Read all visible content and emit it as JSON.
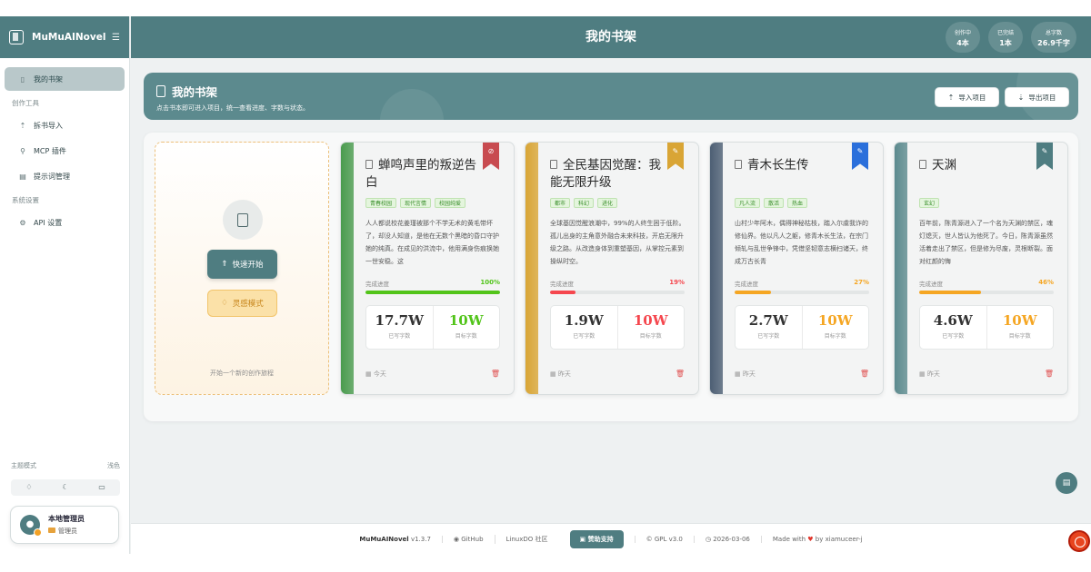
{
  "app": {
    "name": "MuMuAINovel",
    "page_title": "我的书架"
  },
  "sidebar": {
    "items": [
      {
        "label": "我的书架",
        "icon": "book-icon",
        "active": true
      },
      {
        "label": "拆书导入",
        "icon": "upload-icon"
      },
      {
        "label": "MCP 插件",
        "icon": "plug-icon"
      },
      {
        "label": "提示词管理",
        "icon": "file-text-icon"
      },
      {
        "label": "API 设置",
        "icon": "gear-icon"
      }
    ],
    "sections": {
      "tools": "创作工具",
      "system": "系统设置"
    },
    "theme": {
      "label": "主题模式",
      "current": "浅色",
      "options": [
        "bulb-icon",
        "moon-icon",
        "monitor-icon"
      ]
    },
    "user": {
      "name": "本地管理员",
      "role": "管理员"
    }
  },
  "topbar": {
    "stats": [
      {
        "label": "创作中",
        "value": "4本"
      },
      {
        "label": "已完结",
        "value": "1本"
      },
      {
        "label": "总字数",
        "value": "26.9千字"
      }
    ]
  },
  "banner": {
    "title": "我的书架",
    "subtitle": "点击书本即可进入项目，统一查看进度、字数与状态。",
    "import_label": "导入项目",
    "export_label": "导出项目"
  },
  "new_card": {
    "quick_start": "快速开始",
    "inspiration": "灵感模式",
    "footer": "开始一个新的创作旅程"
  },
  "labels": {
    "progress": "完成进度",
    "written": "已写字数",
    "target": "目标字数"
  },
  "books": [
    {
      "title": "蝉鸣声里的叛逆告白",
      "tags": [
        "青春校园",
        "现代言情",
        "校园纯爱"
      ],
      "description": "人人都说校花姜瑾被那个不学无术的黄毛带坏了，却没人知道，是他在无数个黑暗的昏口守护她的纯真。在成见的洪流中，他用满身伤痕换她一世安稳。这",
      "progress": "100%",
      "progress_value": 100,
      "written": "17.7W",
      "target": "10W",
      "date": "今天",
      "color": "#4a9b4e",
      "bar": "#52c41a",
      "rib": "#c84b50",
      "rib_icon": "check-circle-icon",
      "target_color": "#52c41a"
    },
    {
      "title": "全民基因觉醒：我能无限升级",
      "tags": [
        "都市",
        "科幻",
        "进化"
      ],
      "description": "全球基因觉醒浪潮中，99%的人终生困于低阶。孤儿出身的主角意外融合未来科技，开启无限升级之路。从改造身体到重塑基因，从掌控元素到操纵时空。",
      "progress": "19%",
      "progress_value": 19,
      "written": "1.9W",
      "target": "10W",
      "date": "昨天",
      "color": "#d9a535",
      "bar": "#f5474e",
      "rib": "#d9a535",
      "rib_icon": "pen-icon",
      "target_color": "#f5474e"
    },
    {
      "title": "青木长生传",
      "tags": [
        "凡人流",
        "散活",
        "热血"
      ],
      "description": "山村少年阿木，偶得神秘枯枝，踏入尔虞我诈的修仙界。他以凡人之躯，修青木长生法，在宗门倾轧与乱世争锋中，凭借坚韧意志横扫诸天，终成万古长青",
      "progress": "27%",
      "progress_value": 27,
      "written": "2.7W",
      "target": "10W",
      "date": "昨天",
      "color": "#4d5f74",
      "bar": "#f5a623",
      "rib": "#2a6fdb",
      "rib_icon": "pen-icon",
      "target_color": "#f5a623"
    },
    {
      "title": "天渊",
      "tags": [
        "玄幻"
      ],
      "description": "百年前，陈青源进入了一个名为天渊的禁区，魂灯熄灭，世人皆认为他死了。今日，陈青源虽然活着走出了禁区，但是修为尽废，灵根断裂。面对红颜的悔",
      "progress": "46%",
      "progress_value": 46,
      "written": "4.6W",
      "target": "10W",
      "date": "昨天",
      "color": "#5c8a8e",
      "bar": "#f5a623",
      "rib": "#4f7d81",
      "rib_icon": "pen-icon",
      "target_color": "#f5a623"
    }
  ],
  "footer": {
    "product": "MuMuAINovel",
    "version": "v1.3.7",
    "github": "GitHub",
    "linuxdo": "LinuxDO 社区",
    "sponsor": "赞助支持",
    "license": "GPL v3.0",
    "date": "2026-03-06",
    "made_with": "Made with",
    "by": "by xiamuceer-j"
  }
}
